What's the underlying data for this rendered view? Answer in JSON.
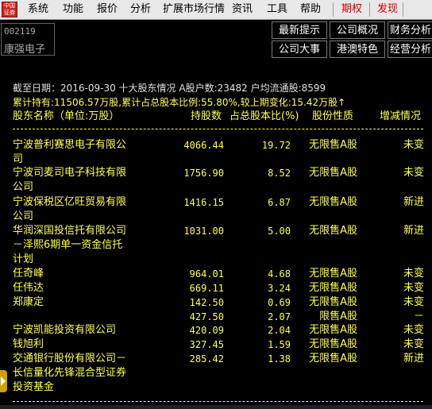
{
  "menu": {
    "logo_text": "中国\n证券",
    "items": [
      "系统",
      "功能",
      "报价",
      "分析",
      "扩展市场行情",
      "资讯",
      "工具",
      "帮助"
    ],
    "special": [
      "期权",
      "发现"
    ]
  },
  "stock": {
    "code": "002119",
    "name": "康强电子"
  },
  "nav": {
    "row1": [
      "最新提示",
      "公司概况",
      "财务分析"
    ],
    "row2": [
      "公司大事",
      "港澳特色",
      "经营分析"
    ]
  },
  "report": {
    "header1": "截至日期：2016-09-30 十大股东情况 A股户数:23482 户均流通股:8599",
    "header2": "累计持有:11506.57万股,累计占总股本比例:55.80%,较上期变化:15.42万股↑",
    "columns": [
      "股东名称（单位:万股）",
      "持股数",
      "占总股本比(%)",
      "股份性质",
      "增减情况"
    ],
    "rows": [
      {
        "name": [
          "宁波普利赛思电子有限公",
          "司"
        ],
        "shares": "4066.44",
        "pct": "19.72",
        "type": "无限售A股",
        "change": "未变"
      },
      {
        "name": [
          "宁波司麦司电子科技有限",
          "公司"
        ],
        "shares": "1756.90",
        "pct": "8.52",
        "type": "无限售A股",
        "change": "未变"
      },
      {
        "name": [
          "宁波保税区亿旺贸易有限",
          "公司"
        ],
        "shares": "1416.15",
        "pct": "6.87",
        "type": "无限售A股",
        "change": "新进"
      },
      {
        "name": [
          "华润深国投信托有限公司",
          "－泽熙6期单一资金信托",
          "计划"
        ],
        "shares": "1031.00",
        "pct": "5.00",
        "type": "无限售A股",
        "change": "新进"
      },
      {
        "name": [
          "任奇峰"
        ],
        "shares": "964.01",
        "pct": "4.68",
        "type": "无限售A股",
        "change": "未变"
      },
      {
        "name": [
          "任伟达"
        ],
        "shares": "669.11",
        "pct": "3.24",
        "type": "无限售A股",
        "change": "未变"
      },
      {
        "name": [
          "郑康定"
        ],
        "shares": "142.50",
        "pct": "0.69",
        "type": "无限售A股",
        "change": "未变"
      },
      {
        "name": [
          ""
        ],
        "shares": "427.50",
        "pct": "2.07",
        "type": "限售A股",
        "change": "－"
      },
      {
        "name": [
          "宁波凯能投资有限公司"
        ],
        "shares": "420.09",
        "pct": "2.04",
        "type": "无限售A股",
        "change": "未变"
      },
      {
        "name": [
          "钱旭利"
        ],
        "shares": "327.45",
        "pct": "1.59",
        "type": "无限售A股",
        "change": "未变"
      },
      {
        "name": [
          "交通银行股份有限公司－",
          "长信量化先锋混合型证券",
          "投资基金"
        ],
        "shares": "285.42",
        "pct": "1.38",
        "type": "无限售A股",
        "change": "新进"
      }
    ]
  },
  "colors": {
    "text_yellow": "#ffff54",
    "menu_red": "#d00000",
    "background": "#000000"
  }
}
